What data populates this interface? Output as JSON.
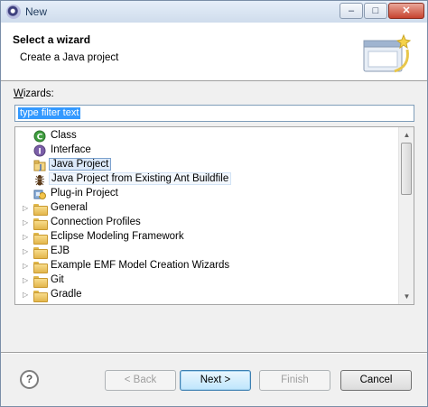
{
  "window": {
    "title": "New",
    "minimize_glyph": "–",
    "maximize_glyph": "□",
    "close_glyph": "✕"
  },
  "header": {
    "title": "Select a wizard",
    "description": "Create a Java project",
    "art_icon": "new-wizard-banner-icon"
  },
  "wizards": {
    "label": "izards:",
    "label_mnemonic": "W",
    "filter_value": "type filter text"
  },
  "tree": {
    "items": [
      {
        "label": "Class",
        "icon": "class-icon",
        "expandable": false
      },
      {
        "label": "Interface",
        "icon": "interface-icon",
        "expandable": false
      },
      {
        "label": "Java Project",
        "icon": "java-project-icon",
        "expandable": false,
        "state": "selected"
      },
      {
        "label": "Java Project from Existing Ant Buildfile",
        "icon": "ant-icon",
        "expandable": false,
        "state": "hover"
      },
      {
        "label": "Plug-in Project",
        "icon": "plugin-project-icon",
        "expandable": false
      },
      {
        "label": "General",
        "icon": "folder-icon",
        "expandable": true
      },
      {
        "label": "Connection Profiles",
        "icon": "folder-icon",
        "expandable": true
      },
      {
        "label": "Eclipse Modeling Framework",
        "icon": "folder-icon",
        "expandable": true
      },
      {
        "label": "EJB",
        "icon": "folder-icon",
        "expandable": true
      },
      {
        "label": "Example EMF Model Creation Wizards",
        "icon": "folder-icon",
        "expandable": true
      },
      {
        "label": "Git",
        "icon": "folder-icon",
        "expandable": true
      },
      {
        "label": "Gradle",
        "icon": "folder-icon",
        "expandable": true
      }
    ],
    "expand_glyph": "▷",
    "scroll_up_glyph": "▲",
    "scroll_down_glyph": "▼"
  },
  "buttons": {
    "help_glyph": "?",
    "back": "< Back",
    "next": "Next >",
    "finish": "Finish",
    "cancel": "Cancel"
  },
  "colors": {
    "selection": "#3399ff",
    "default_button_border": "#3c7fb1"
  }
}
